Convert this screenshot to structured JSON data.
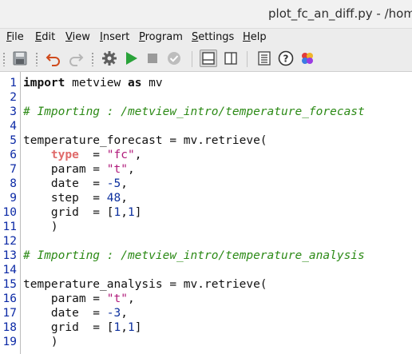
{
  "window": {
    "title": "plot_fc_an_diff.py - /home"
  },
  "menu": [
    {
      "mnemonic": "F",
      "rest": "ile"
    },
    {
      "mnemonic": "E",
      "rest": "dit"
    },
    {
      "mnemonic": "V",
      "rest": "iew"
    },
    {
      "mnemonic": "I",
      "rest": "nsert"
    },
    {
      "mnemonic": "P",
      "rest": "rogram"
    },
    {
      "mnemonic": "S",
      "rest": "ettings"
    },
    {
      "mnemonic": "H",
      "rest": "elp"
    }
  ],
  "toolbar": {
    "icons": [
      "save-icon",
      "undo-icon",
      "redo-icon",
      "settings-icon",
      "run-icon",
      "stop-icon",
      "check-icon",
      "split-horizontal-icon",
      "split-vertical-icon",
      "outline-icon",
      "help-icon",
      "palette-icon"
    ],
    "active": "split-horizontal-icon"
  },
  "colors": {
    "line_numbers": "#0c2aa6",
    "comment": "#2c8a16",
    "string": "#b0197a",
    "number": "#0b2f9e",
    "keyword_arg": "#e06a6a",
    "run": "#2aa33a"
  },
  "editor": {
    "line_numbers": [
      "1",
      "2",
      "3",
      "4",
      "5",
      "6",
      "7",
      "8",
      "9",
      "10",
      "11",
      "12",
      "13",
      "14",
      "15",
      "16",
      "17",
      "18",
      "19"
    ],
    "lines": [
      {
        "t1": "import",
        "t2": " metview ",
        "t3": "as",
        "t4": " mv"
      },
      {},
      {
        "comment": "# Importing : /metview_intro/temperature_forecast"
      },
      {},
      {
        "text": "temperature_forecast = mv.retrieve("
      },
      {
        "a": "    ",
        "kw": "type",
        "b": "  = ",
        "val": "\"fc\"",
        "c": ","
      },
      {
        "a": "    param = ",
        "val": "\"t\"",
        "c": ","
      },
      {
        "a": "    date  = ",
        "val": "-5",
        "c": ","
      },
      {
        "a": "    step  = ",
        "val": "48",
        "c": ","
      },
      {
        "a": "    grid  = [",
        "v1": "1",
        "m": ",",
        "v2": "1",
        "c": "]"
      },
      {
        "text": "    )"
      },
      {},
      {
        "comment": "# Importing : /metview_intro/temperature_analysis"
      },
      {},
      {
        "text": "temperature_analysis = mv.retrieve("
      },
      {
        "a": "    param = ",
        "val": "\"t\"",
        "c": ","
      },
      {
        "a": "    date  = ",
        "val": "-3",
        "c": ","
      },
      {
        "a": "    grid  = [",
        "v1": "1",
        "m": ",",
        "v2": "1",
        "c": "]"
      },
      {
        "text": "    )"
      }
    ]
  }
}
